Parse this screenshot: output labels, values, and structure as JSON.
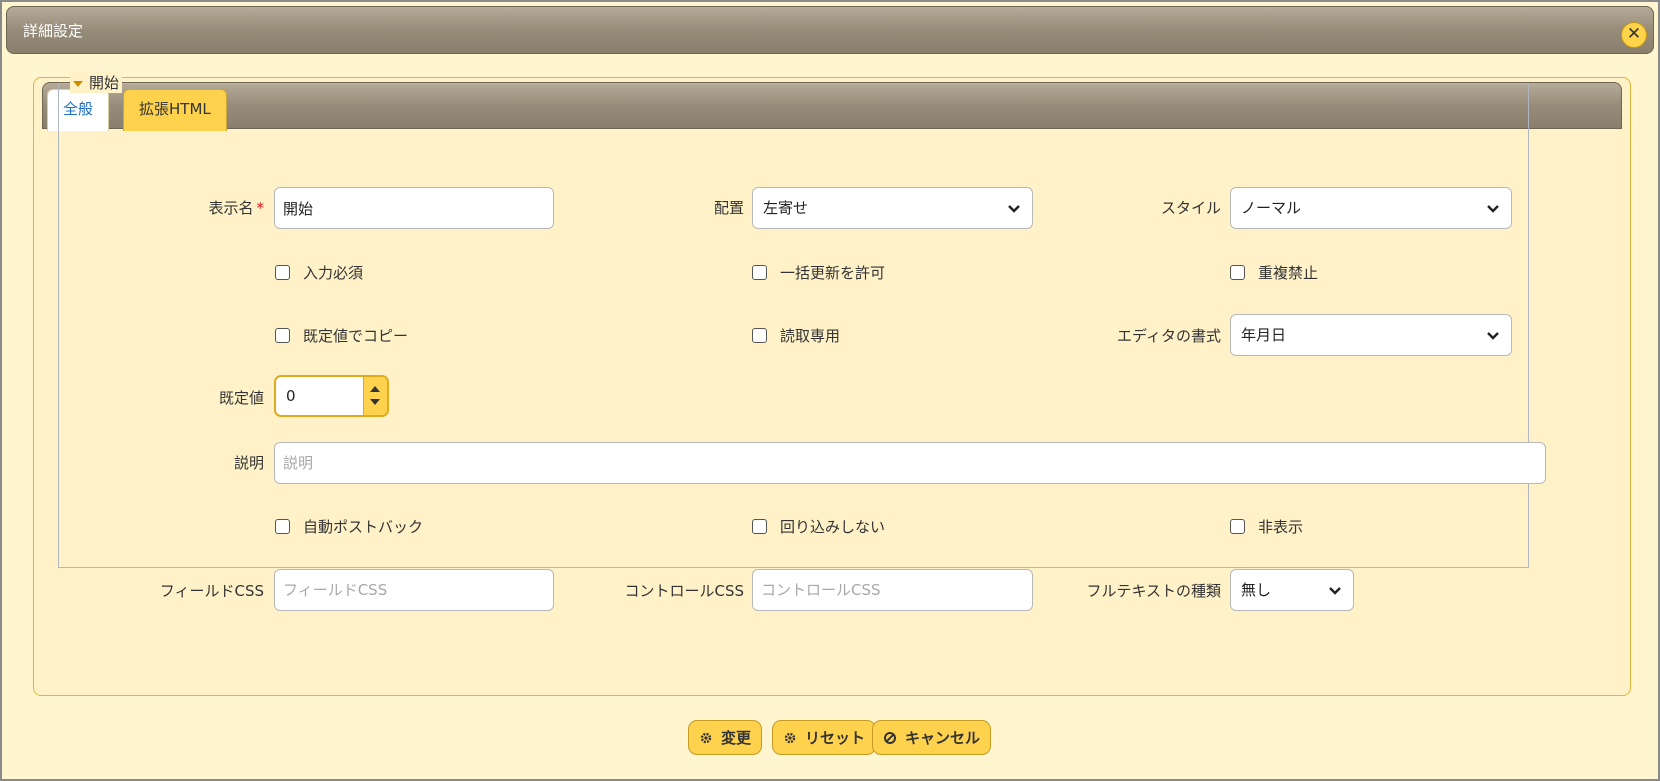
{
  "dialog": {
    "title": "詳細設定"
  },
  "tabs": [
    {
      "label": "全般",
      "active": true
    },
    {
      "label": "拡張HTML",
      "active": false
    }
  ],
  "section": {
    "legend": "開始"
  },
  "fields": {
    "display_name": {
      "label": "表示名",
      "required_mark": "*",
      "value": "開始"
    },
    "alignment": {
      "label": "配置",
      "value": "左寄せ"
    },
    "style": {
      "label": "スタイル",
      "value": "ノーマル"
    },
    "required": {
      "label": "入力必須",
      "checked": false
    },
    "bulk_update": {
      "label": "一括更新を許可",
      "checked": false
    },
    "no_duplicates": {
      "label": "重複禁止",
      "checked": false
    },
    "copy_default": {
      "label": "既定値でコピー",
      "checked": false
    },
    "read_only": {
      "label": "読取専用",
      "checked": false
    },
    "editor_format": {
      "label": "エディタの書式",
      "value": "年月日"
    },
    "default_value": {
      "label": "既定値",
      "value": "0"
    },
    "description": {
      "label": "説明",
      "value": "",
      "placeholder": "説明"
    },
    "auto_postback": {
      "label": "自動ポストバック",
      "checked": false
    },
    "no_wrap": {
      "label": "回り込みしない",
      "checked": false
    },
    "hidden": {
      "label": "非表示",
      "checked": false
    },
    "field_css": {
      "label": "フィールドCSS",
      "value": "",
      "placeholder": "フィールドCSS"
    },
    "control_css": {
      "label": "コントロールCSS",
      "value": "",
      "placeholder": "コントロールCSS"
    },
    "fulltext_type": {
      "label": "フルテキストの種類",
      "value": "無し"
    }
  },
  "buttons": {
    "change": "変更",
    "reset": "リセット",
    "cancel": "キャンセル"
  },
  "colors": {
    "accent": "#ffd24d",
    "panel_bg": "#fff2c8",
    "active_tab_text": "#1e6fc7",
    "required": "#d41515"
  }
}
